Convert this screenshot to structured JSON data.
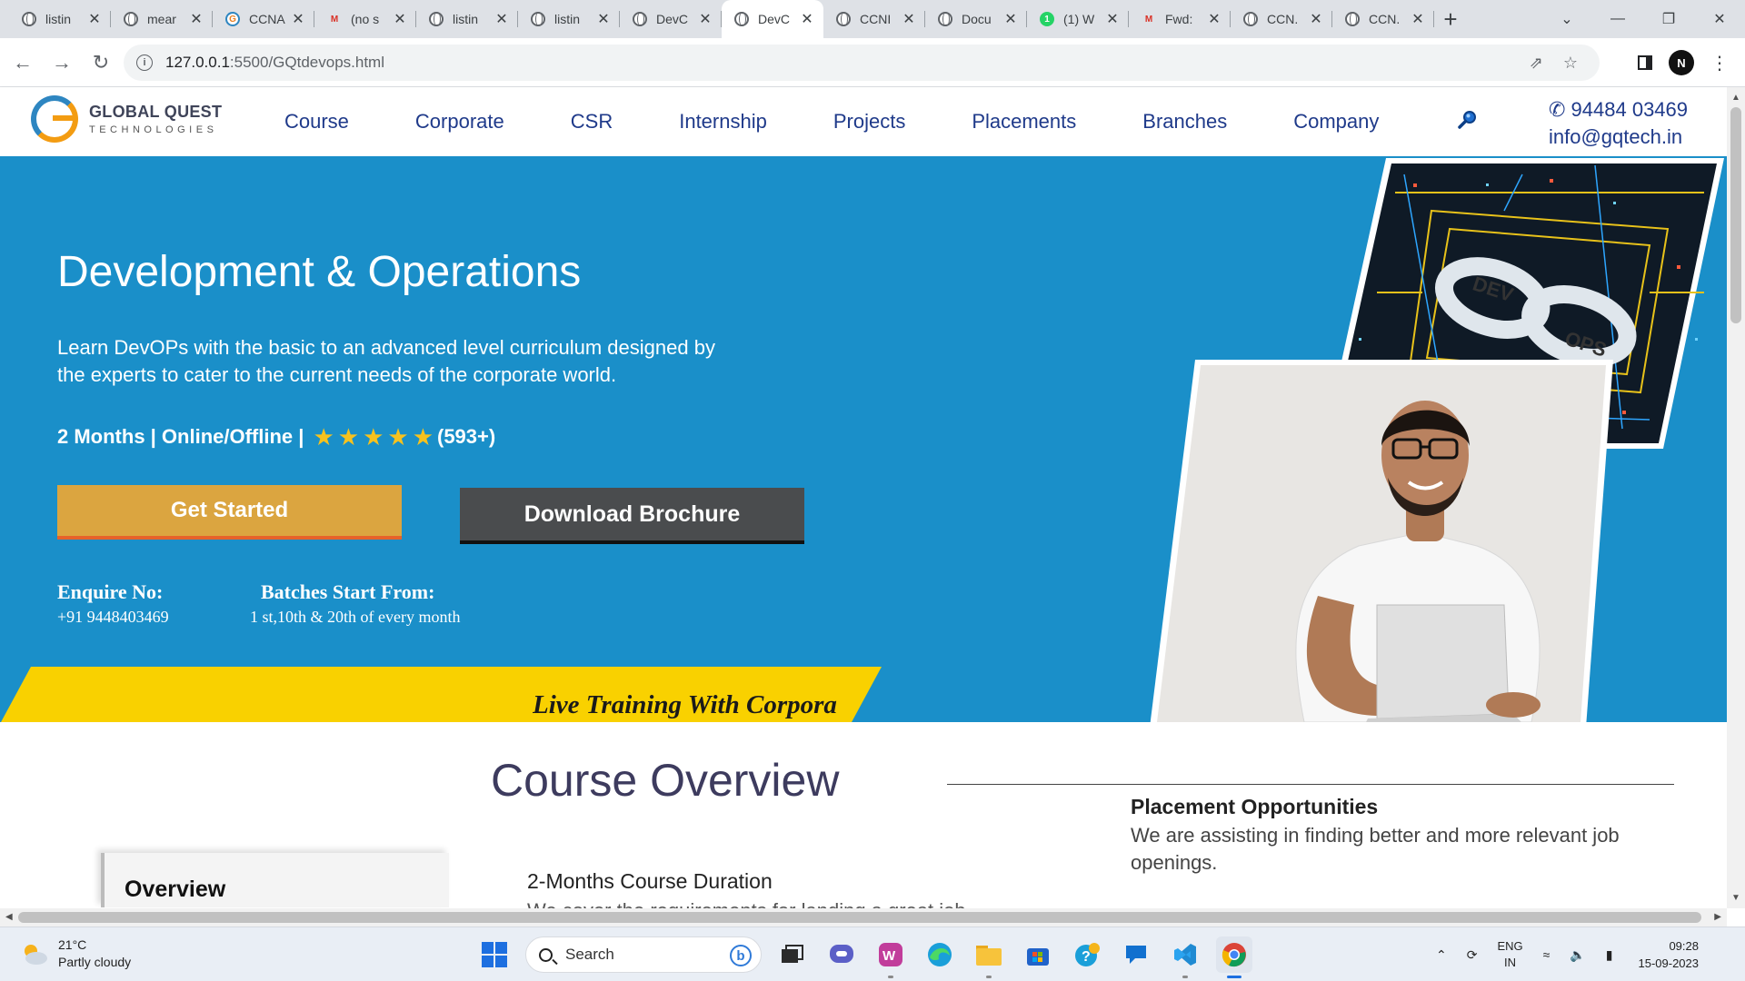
{
  "browser": {
    "tabs": [
      {
        "title": "listin",
        "icon": "globe"
      },
      {
        "title": "mear",
        "icon": "globe"
      },
      {
        "title": "CCNA",
        "icon": "gq"
      },
      {
        "title": "(no s",
        "icon": "gmail"
      },
      {
        "title": "listin",
        "icon": "globe"
      },
      {
        "title": "listin",
        "icon": "globe"
      },
      {
        "title": "DevC",
        "icon": "globe"
      },
      {
        "title": "DevC",
        "icon": "globe",
        "active": true
      },
      {
        "title": "CCNI",
        "icon": "globe"
      },
      {
        "title": "Docu",
        "icon": "globe"
      },
      {
        "title": "(1) W",
        "icon": "whatsapp"
      },
      {
        "title": "Fwd:",
        "icon": "gmail"
      },
      {
        "title": "CCN.",
        "icon": "globe"
      },
      {
        "title": "CCN.",
        "icon": "globe"
      }
    ],
    "new_tab": "+",
    "url_host": "127.0.0.1",
    "url_rest": ":5500/GQtdevops.html",
    "profile_initial": "N"
  },
  "site": {
    "logo_line1": "GLOBAL QUEST",
    "logo_line2": "TECHNOLOGIES",
    "nav": [
      "Course",
      "Corporate",
      "CSR",
      "Internship",
      "Projects",
      "Placements",
      "Branches",
      "Company"
    ],
    "phone": "✆ 94484 03469",
    "email": "info@gqtech.in"
  },
  "hero": {
    "title": "Development & Operations",
    "lead": "Learn DevOPs with the basic to an advanced level curriculum designed by the experts to cater to the current needs of the corporate world.",
    "meta": "2 Months | Online/Offline |",
    "rating_stars": 5,
    "rating_count": "(593+)",
    "cta_primary": "Get Started",
    "cta_secondary": "Download Brochure",
    "enquire_label": "Enquire No:",
    "enquire_value": "+91 9448403469",
    "batch_label": "Batches Start From:",
    "batch_value": "1 st,10th & 20th of every month",
    "ribbon_text": "Live Training With Corpora",
    "devops_badge_left": "DEV",
    "devops_badge_right": "OPS",
    "colors": {
      "hero_bg": "#1a8fc9",
      "ribbon": "#f9d100",
      "cta_primary": "#dba540",
      "cta_secondary": "#4a4c4e"
    }
  },
  "overview": {
    "title": "Course Overview",
    "placement_heading": "Placement Opportunities",
    "placement_text": "We are assisting in finding better and more relevant job openings.",
    "sidebar_card": "Overview",
    "duration_heading": "2-Months Course Duration",
    "duration_text": "We cover the requirements for landing a great job"
  },
  "taskbar": {
    "temp": "21°C",
    "weather": "Partly cloudy",
    "search_placeholder": "Search",
    "lang1": "ENG",
    "lang2": "IN",
    "time": "09:28",
    "date": "15-09-2023"
  }
}
